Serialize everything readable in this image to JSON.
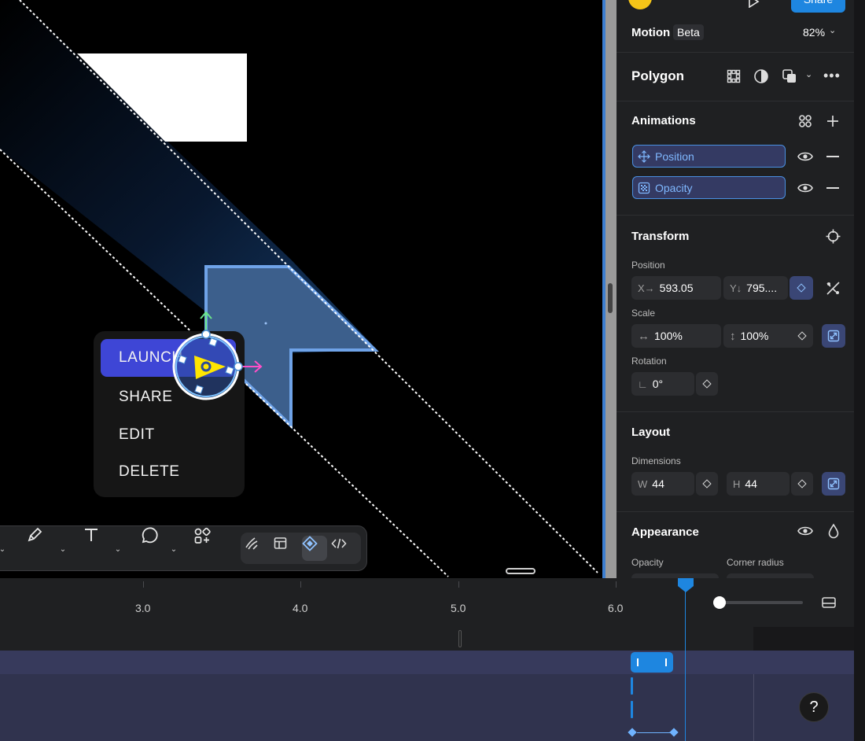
{
  "canvas": {
    "context_menu": {
      "items": [
        "LAUNCH",
        "SHARE",
        "EDIT",
        "DELETE"
      ],
      "active_index": 0
    }
  },
  "toolbar": {
    "tools": [
      "pen-icon",
      "text-icon",
      "shape-icon",
      "components-icon"
    ],
    "modes": [
      "draw-icon",
      "table-icon",
      "motion-icon",
      "code-icon"
    ]
  },
  "panel": {
    "header": {
      "share_label": "Share"
    },
    "motion": {
      "title": "Motion",
      "badge": "Beta",
      "zoom": "82%"
    },
    "layer": {
      "name": "Polygon"
    },
    "animations": {
      "title": "Animations",
      "items": [
        "Position",
        "Opacity"
      ]
    },
    "transform": {
      "title": "Transform",
      "position_label": "Position",
      "x_prefix": "X→",
      "x_value": "593.05",
      "y_prefix": "Y↓",
      "y_value": "795....",
      "scale_label": "Scale",
      "scale_w": "100%",
      "scale_h": "100%",
      "rotation_label": "Rotation",
      "rotation_value": "0°"
    },
    "layout": {
      "title": "Layout",
      "dimensions_label": "Dimensions",
      "w_prefix": "W",
      "w_value": "44",
      "h_prefix": "H",
      "h_value": "44"
    },
    "appearance": {
      "title": "Appearance",
      "opacity_label": "Opacity",
      "corner_label": "Corner radius"
    }
  },
  "timeline": {
    "ticks": [
      "3.0",
      "4.0",
      "5.0",
      "6.0"
    ],
    "playhead_time": 6.45,
    "zoom_slider": 0.05
  },
  "help": {
    "label": "?"
  },
  "colors": {
    "accent": "#3d7fd1",
    "selection": "#3e46d6",
    "track": "#333650",
    "keyframe": "#6fb3ff"
  }
}
